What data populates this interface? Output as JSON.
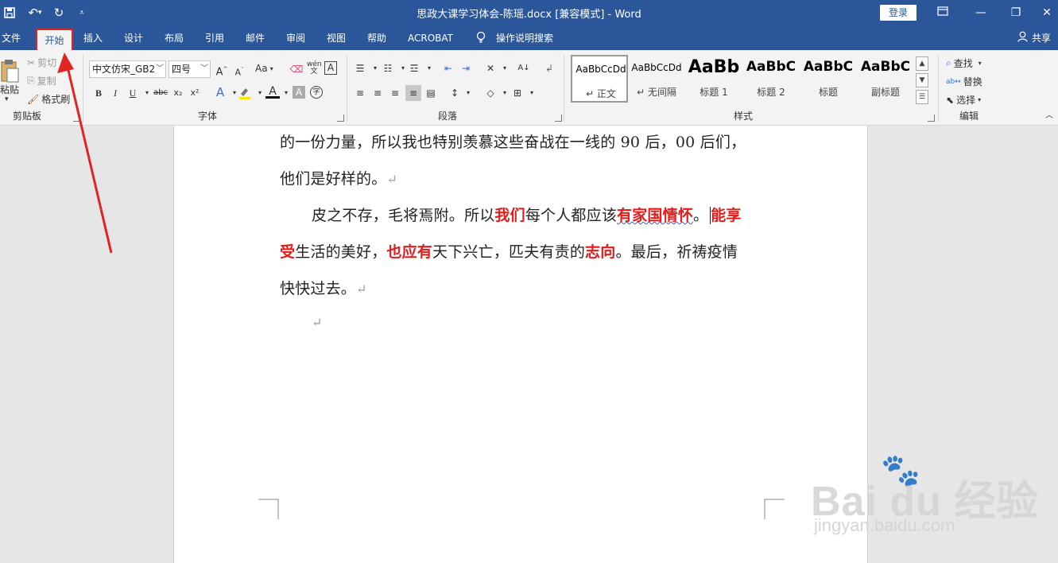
{
  "window": {
    "title": "思政大课学习体会-陈瑶.docx [兼容模式]  -  Word",
    "login_label": "登录",
    "share_label": "共享"
  },
  "quick_access": {
    "icons": [
      "save-icon",
      "undo-icon",
      "redo-icon",
      "customize-icon"
    ]
  },
  "menu": {
    "tabs": [
      "文件",
      "开始",
      "插入",
      "设计",
      "布局",
      "引用",
      "邮件",
      "审阅",
      "视图",
      "帮助",
      "ACROBAT"
    ],
    "active_tab": "开始",
    "tell_me": "操作说明搜索"
  },
  "clipboard": {
    "label": "剪贴板",
    "paste": "粘贴",
    "cut": "剪切",
    "copy": "复制",
    "format_painter": "格式刷"
  },
  "font": {
    "label": "字体",
    "font_name": "中文仿宋_GB2",
    "font_size": "四号",
    "case_label": "Aa",
    "buttons": [
      "B",
      "I",
      "U",
      "abc",
      "x₂",
      "x²",
      "A",
      "A",
      "A"
    ]
  },
  "paragraph": {
    "label": "段落"
  },
  "styles": {
    "label": "样式",
    "items": [
      {
        "preview": "AaBbCcDd",
        "name": "↵ 正文"
      },
      {
        "preview": "AaBbCcDd",
        "name": "↵ 无间隔"
      },
      {
        "preview": "AaBb",
        "name": "标题 1"
      },
      {
        "preview": "AaBbC",
        "name": "标题 2"
      },
      {
        "preview": "AaBbC",
        "name": "标题"
      },
      {
        "preview": "AaBbC",
        "name": "副标题"
      }
    ]
  },
  "editing": {
    "label": "编辑",
    "find": "查找",
    "replace": "替换",
    "select": "选择"
  },
  "document": {
    "line1": "的一份力量，所以我也特别羡慕这些奋战在一线的 90 后，00 后们，",
    "line2": "他们是好样的。",
    "para_mark": "↵",
    "line3": {
      "a": "皮之不存，毛将焉附。所以",
      "b": "我们",
      "c": "每个人都应该",
      "d": "有家国情怀",
      "e": "。",
      "f": "能享"
    },
    "line4": {
      "a": "受",
      "b": "生活的美好，",
      "c": "也应有",
      "d": "天下兴亡，匹夫有责的",
      "e": "志向",
      "f": "。最后，祈祷疫情"
    },
    "line5": "快快过去。",
    "highlight_color": "#e31b1b"
  },
  "watermark": {
    "brand": "Bai  du 经验",
    "url": "jingyan.baidu.com"
  },
  "colors": {
    "title_bar": "#2b579a",
    "annotation": "#e02424"
  }
}
